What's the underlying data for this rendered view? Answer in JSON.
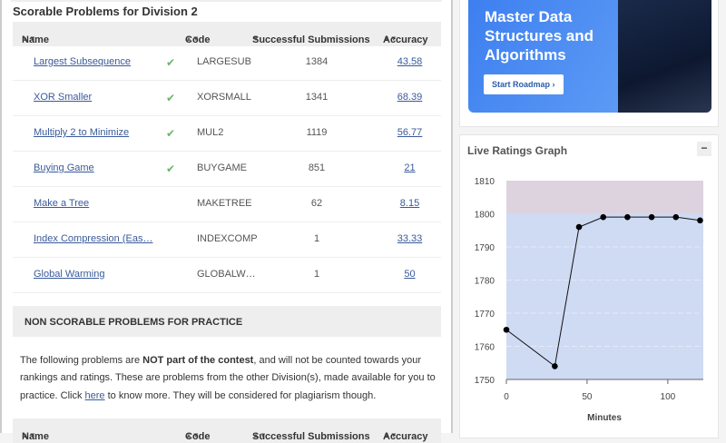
{
  "scorable": {
    "title": "Scorable Problems for Division 2",
    "headers": {
      "name": "Name",
      "code": "Code",
      "subs": "Successful Submissions",
      "acc": "Accuracy"
    },
    "rows": [
      {
        "name": "Largest Subsequence",
        "solved": true,
        "code": "LARGESUB",
        "subs": "1384",
        "acc": "43.58"
      },
      {
        "name": "XOR Smaller",
        "solved": true,
        "code": "XORSMALL",
        "subs": "1341",
        "acc": "68.39"
      },
      {
        "name": "Multiply 2 to Minimize",
        "solved": true,
        "code": "MUL2",
        "subs": "1119",
        "acc": "56.77"
      },
      {
        "name": "Buying Game",
        "solved": true,
        "code": "BUYGAME",
        "subs": "851",
        "acc": "21"
      },
      {
        "name": "Make a Tree",
        "solved": false,
        "code": "MAKETREE",
        "subs": "62",
        "acc": "8.15"
      },
      {
        "name": "Index Compression (Eas…",
        "solved": false,
        "code": "INDEXCOMP",
        "subs": "1",
        "acc": "33.33"
      },
      {
        "name": "Global Warming",
        "solved": false,
        "code": "GLOBALW…",
        "subs": "1",
        "acc": "50"
      }
    ],
    "check_glyph": "✔"
  },
  "nonscorable": {
    "title": "NON SCORABLE PROBLEMS FOR PRACTICE",
    "p1": "The following problems are ",
    "bold": "NOT part of the contest",
    "p2": ", and will not be counted towards your rankings and ratings. These are problems from the other Division(s), made available for you to practice. Click ",
    "link": "here",
    "p3": " to know more. They will be considered for plagiarism though.",
    "headers": {
      "name": "Name",
      "code": "Code",
      "subs": "Successful Submissions",
      "acc": "Accuracy"
    }
  },
  "ad": {
    "line1": "Master Data",
    "line2": "Structures and",
    "line3": "Algorithms",
    "button": "Start Roadmap  ›"
  },
  "graph": {
    "title": "Live Ratings Graph",
    "collapse": "−"
  },
  "chart_data": {
    "type": "line",
    "title": "Live Ratings Graph",
    "xlabel": "Minutes",
    "ylabel": "",
    "x": [
      0,
      30,
      45,
      60,
      75,
      90,
      105,
      120
    ],
    "values": [
      1765,
      1754,
      1796,
      1799,
      1799,
      1799,
      1799,
      1798
    ],
    "xlim": [
      0,
      122
    ],
    "ylim": [
      1750,
      1810
    ],
    "xticks": [
      0,
      50,
      100
    ],
    "yticks": [
      1750,
      1760,
      1770,
      1780,
      1790,
      1800,
      1810
    ],
    "bands": [
      {
        "from": 1750,
        "to": 1800,
        "color": "#cfdaf3"
      },
      {
        "from": 1800,
        "to": 1810,
        "color": "#dcd3df"
      }
    ],
    "grid": true
  }
}
